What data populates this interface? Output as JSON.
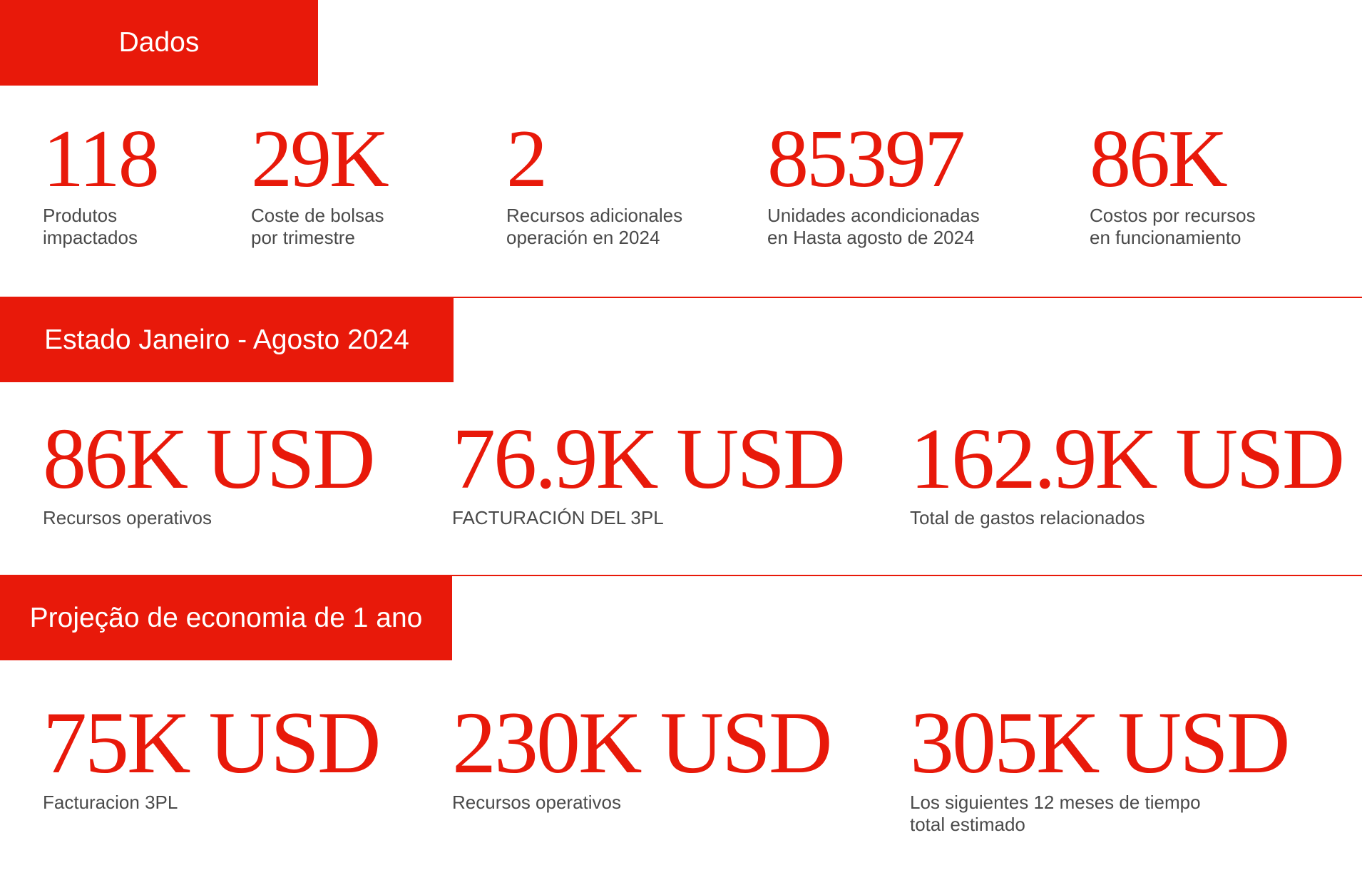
{
  "colors": {
    "accent": "#e8190a",
    "label_text": "#4a4a4a",
    "background": "#ffffff"
  },
  "section_data": {
    "title": "Dados",
    "stats": [
      {
        "value": "118",
        "label_line1": "Produtos",
        "label_line2": "impactados"
      },
      {
        "value": "29K",
        "label_line1": "Coste de bolsas",
        "label_line2": "por trimestre"
      },
      {
        "value": "2",
        "label_line1": "Recursos adicionales",
        "label_line2": "operación en 2024"
      },
      {
        "value": "85397",
        "label_line1": "Unidades acondicionadas",
        "label_line2": "en Hasta agosto de 2024"
      },
      {
        "value": "86K",
        "label_line1": "Costos por recursos",
        "label_line2": "en funcionamiento"
      }
    ]
  },
  "section_status": {
    "title": "Estado Janeiro - Agosto 2024",
    "stats": [
      {
        "value": "86K USD",
        "label_line1": "Recursos operativos"
      },
      {
        "value": "76.9K USD",
        "label_line1": "FACTURACIÓN DEL 3PL"
      },
      {
        "value": "162.9K USD",
        "label_line1": "Total de gastos relacionados"
      }
    ]
  },
  "section_projection": {
    "title": "Projeção de economia de 1 ano",
    "stats": [
      {
        "value": "75K USD",
        "label_line1": "Facturacion 3PL"
      },
      {
        "value": "230K USD",
        "label_line1": "Recursos operativos"
      },
      {
        "value": "305K USD",
        "label_line1": "Los siguientes 12 meses de tiempo",
        "label_line2": "total estimado"
      }
    ]
  }
}
